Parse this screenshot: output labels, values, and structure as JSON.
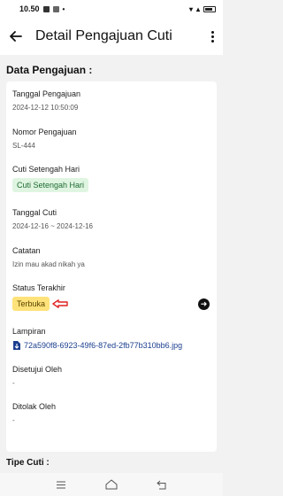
{
  "status_bar": {
    "time": "10.50"
  },
  "app_bar": {
    "title": "Detail Pengajuan Cuti"
  },
  "section": {
    "title": "Data Pengajuan :"
  },
  "fields": {
    "tanggal_pengajuan": {
      "label": "Tanggal Pengajuan",
      "value": "2024-12-12 10:50:09"
    },
    "nomor_pengajuan": {
      "label": "Nomor Pengajuan",
      "value": "SL-444"
    },
    "cuti_setengah_hari": {
      "label": "Cuti Setengah Hari",
      "badge": "Cuti Setengah Hari"
    },
    "tanggal_cuti": {
      "label": "Tanggal Cuti",
      "value": "2024-12-16 ~ 2024-12-16"
    },
    "catatan": {
      "label": "Catatan",
      "value": "Izin mau akad nikah ya"
    },
    "status_terakhir": {
      "label": "Status Terakhir",
      "badge": "Terbuka"
    },
    "lampiran": {
      "label": "Lampiran",
      "file": "72a590f8-6923-49f6-87ed-2fb77b310bb6.jpg"
    },
    "disetujui_oleh": {
      "label": "Disetujui Oleh",
      "value": "-"
    },
    "ditolak_oleh": {
      "label": "Ditolak Oleh",
      "value": "-"
    }
  },
  "footer_section": {
    "title": "Tipe Cuti :"
  },
  "colors": {
    "badge_green_bg": "#dff5e1",
    "badge_yellow_bg": "#ffe27a",
    "annotation_arrow": "#e02020",
    "attachment_link": "#1b3f8f"
  },
  "icons": [
    "back-arrow-icon",
    "more-vert-icon",
    "arrow-right-circle-icon",
    "download-file-icon",
    "annotation-arrow-icon"
  ]
}
